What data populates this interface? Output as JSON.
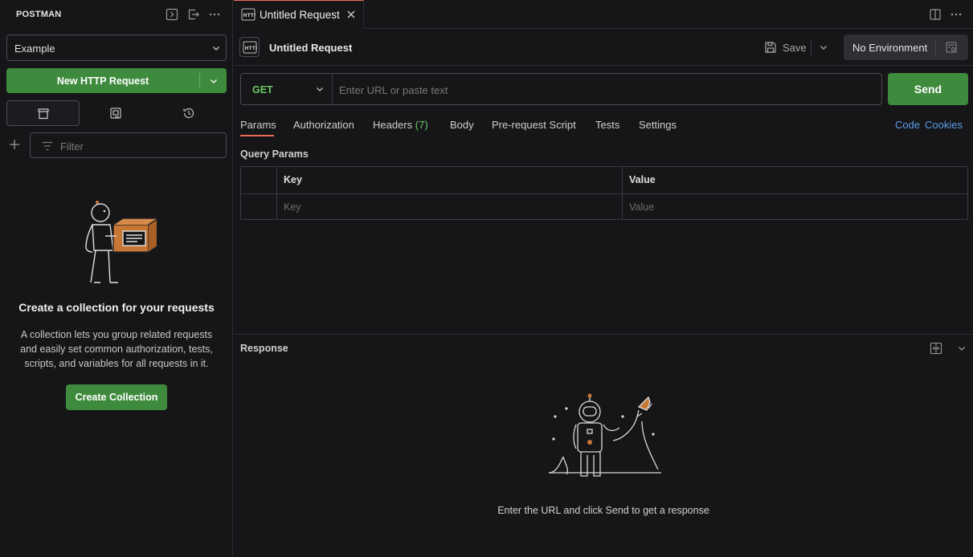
{
  "sidebar": {
    "title": "POSTMAN",
    "header_icons": [
      "sidebar-collapse-icon",
      "import-icon",
      "more-icon"
    ],
    "workspace": "Example",
    "new_request_label": "New HTTP Request",
    "tabs": [
      {
        "icon": "collections-icon",
        "active": true
      },
      {
        "icon": "environments-icon",
        "active": false
      },
      {
        "icon": "history-icon",
        "active": false
      }
    ],
    "filter_placeholder": "Filter",
    "empty_title": "Create a collection for your requests",
    "empty_desc": "A collection lets you group related requests and easily set common authorization, tests, scripts, and variables for all requests in it.",
    "create_collection_label": "Create Collection"
  },
  "tabbar": {
    "tab_label": "Untitled Request",
    "icons": [
      "split-view-icon",
      "more-icon"
    ]
  },
  "request": {
    "name": "Untitled Request",
    "save_label": "Save",
    "environment": "No Environment",
    "method": "GET",
    "url_placeholder": "Enter URL or paste text",
    "send_label": "Send",
    "tabs": [
      {
        "label": "Params",
        "active": true
      },
      {
        "label": "Authorization"
      },
      {
        "label": "Headers",
        "count": "(7)"
      },
      {
        "label": "Body"
      },
      {
        "label": "Pre-request Script"
      },
      {
        "label": "Tests"
      },
      {
        "label": "Settings"
      }
    ],
    "links": [
      "Code",
      "Cookies"
    ],
    "query_params_label": "Query Params",
    "table": {
      "headers": [
        "Key",
        "Value"
      ],
      "placeholders": [
        "Key",
        "Value"
      ]
    }
  },
  "response": {
    "title": "Response",
    "message": "Enter the URL and click Send to get a response"
  },
  "colors": {
    "accent_green": "#3f8b3d",
    "method_green": "#6bc968",
    "link_blue": "#5b9de8",
    "active_tab": "#e86c5a"
  }
}
